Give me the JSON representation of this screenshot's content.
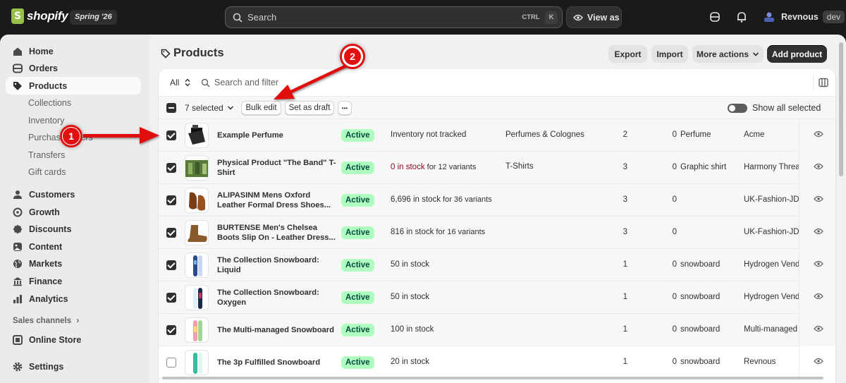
{
  "topbar": {
    "logo_text": "shopify",
    "version": "Spring '26",
    "search_placeholder": "Search",
    "kbd_ctrl": "CTRL",
    "kbd_k": "K",
    "view_as": "View as",
    "user_name": "Revnous",
    "user_badge": "dev"
  },
  "sidebar": {
    "items": [
      {
        "label": "Home",
        "icon": "home-icon"
      },
      {
        "label": "Orders",
        "icon": "orders-icon"
      },
      {
        "label": "Products",
        "icon": "tag-icon"
      }
    ],
    "product_subitems": [
      "Collections",
      "Inventory",
      "Purchase orders",
      "Transfers",
      "Gift cards"
    ],
    "items2": [
      {
        "label": "Customers",
        "icon": "person-icon"
      },
      {
        "label": "Growth",
        "icon": "growth-icon"
      },
      {
        "label": "Discounts",
        "icon": "discount-icon"
      },
      {
        "label": "Content",
        "icon": "content-icon"
      },
      {
        "label": "Markets",
        "icon": "globe-icon"
      },
      {
        "label": "Finance",
        "icon": "finance-icon"
      },
      {
        "label": "Analytics",
        "icon": "analytics-icon"
      }
    ],
    "sales_channels": "Sales channels",
    "online_store": "Online Store",
    "settings": "Settings"
  },
  "page": {
    "title": "Products",
    "export": "Export",
    "import": "Import",
    "more_actions": "More actions",
    "add_product": "Add product"
  },
  "filters": {
    "all": "All",
    "search_placeholder": "Search and filter"
  },
  "bulk": {
    "selected": "7 selected",
    "bulk_edit": "Bulk edit",
    "set_as_draft": "Set as draft",
    "more": "•••",
    "show_all": "Show all selected"
  },
  "rows": [
    {
      "name": "Example Perfume",
      "status": "Active",
      "inv_main": "Inventory not tracked",
      "inv_red": "",
      "inv_small": "",
      "category": "Perfumes & Colognes",
      "count": "2",
      "markets": "0",
      "type": "Perfume",
      "vendor": "Acme",
      "checked": true
    },
    {
      "name": "Physical Product \"The Band\" T-Shirt",
      "status": "Active",
      "inv_main": "",
      "inv_red": "0 in stock",
      "inv_small": " for 12 variants",
      "category": "T-Shirts",
      "count": "3",
      "markets": "0",
      "type": "Graphic shirt",
      "vendor": "Harmony Threads",
      "checked": true
    },
    {
      "name": "ALIPASINM Mens Oxford Leather Formal Dress Shoes...",
      "status": "Active",
      "inv_main": "6,696 in stock",
      "inv_red": "",
      "inv_small": " for 36 variants",
      "category": "",
      "count": "3",
      "markets": "0",
      "type": "",
      "vendor": "UK-Fashion-JD",
      "checked": true
    },
    {
      "name": "BURTENSE Men's Chelsea Boots Slip On - Leather Dress...",
      "status": "Active",
      "inv_main": "816 in stock",
      "inv_red": "",
      "inv_small": " for 16 variants",
      "category": "",
      "count": "3",
      "markets": "0",
      "type": "",
      "vendor": "UK-Fashion-JD",
      "checked": true
    },
    {
      "name": "The Collection Snowboard: Liquid",
      "status": "Active",
      "inv_main": "50 in stock",
      "inv_red": "",
      "inv_small": "",
      "category": "",
      "count": "1",
      "markets": "0",
      "type": "snowboard",
      "vendor": "Hydrogen Vendor",
      "checked": true
    },
    {
      "name": "The Collection Snowboard: Oxygen",
      "status": "Active",
      "inv_main": "50 in stock",
      "inv_red": "",
      "inv_small": "",
      "category": "",
      "count": "1",
      "markets": "0",
      "type": "snowboard",
      "vendor": "Hydrogen Vendor",
      "checked": true
    },
    {
      "name": "The Multi-managed Snowboard",
      "status": "Active",
      "inv_main": "100 in stock",
      "inv_red": "",
      "inv_small": "",
      "category": "",
      "count": "1",
      "markets": "0",
      "type": "snowboard",
      "vendor": "Multi-managed Vendor",
      "checked": true
    },
    {
      "name": "The 3p Fulfilled Snowboard",
      "status": "Active",
      "inv_main": "20 in stock",
      "inv_red": "",
      "inv_small": "",
      "category": "",
      "count": "1",
      "markets": "0",
      "type": "snowboard",
      "vendor": "Revnous",
      "checked": false
    }
  ],
  "annotations": {
    "callout1": "1",
    "callout2": "2"
  },
  "colors": {
    "active_badge_bg": "#affebf",
    "active_badge_text": "#014b40",
    "annotation_red": "#e01010",
    "stock_red": "#8e0b21"
  }
}
